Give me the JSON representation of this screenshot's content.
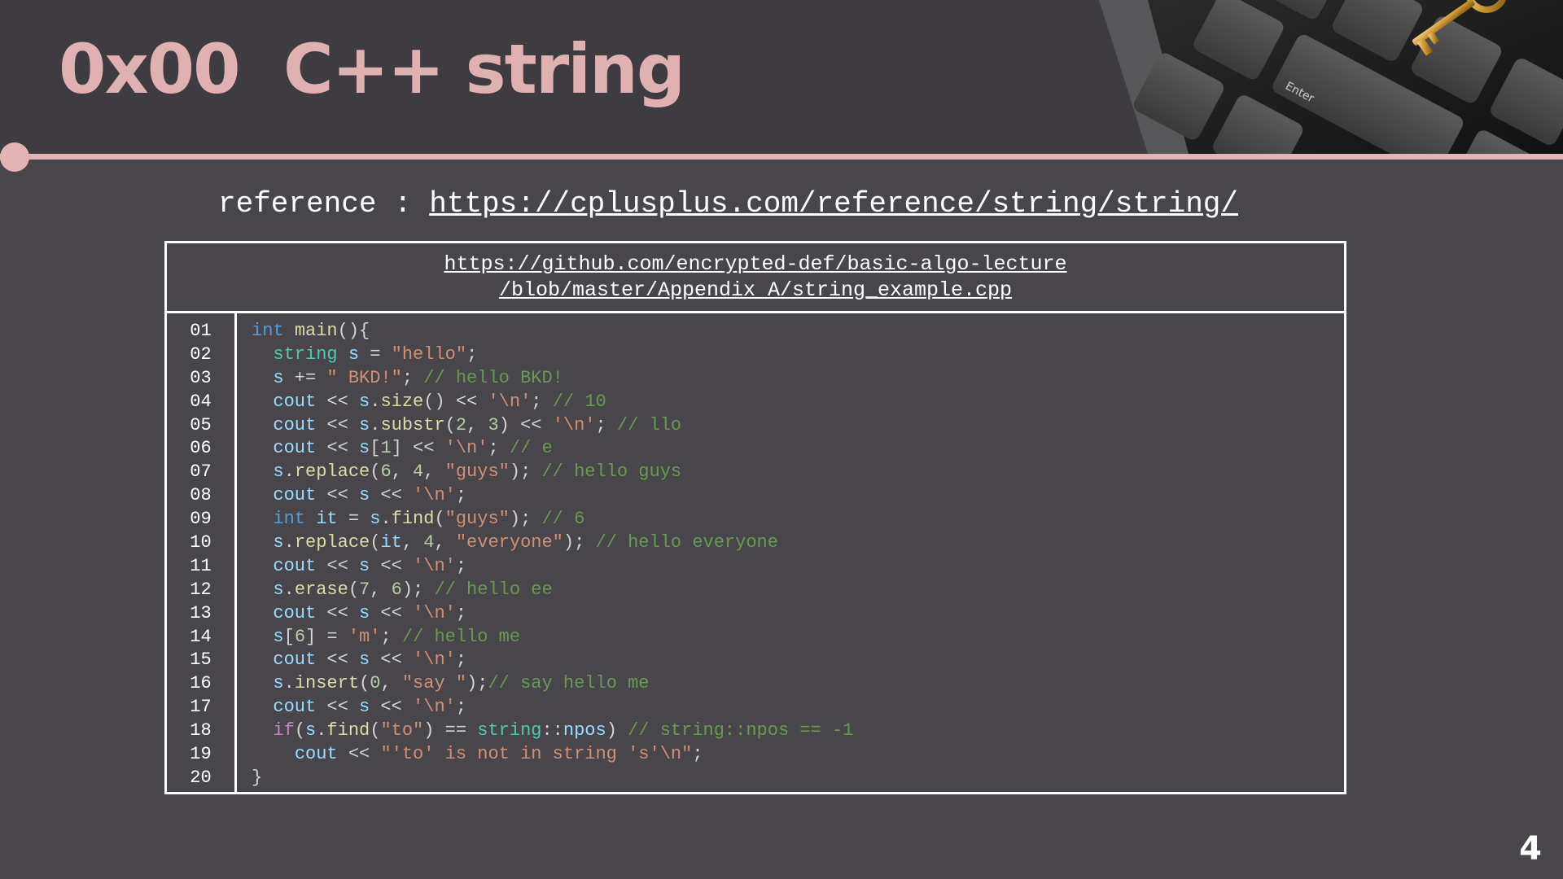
{
  "slide": {
    "title": "0x00  C++ string",
    "page_number": "4"
  },
  "reference": {
    "label": "reference : ",
    "url": "https://cplusplus.com/reference/string/string/"
  },
  "source_file": {
    "line1": "https://github.com/encrypted-def/basic-algo-lecture",
    "line2": "/blob/master/Appendix A/string_example.cpp"
  },
  "line_numbers": [
    "01",
    "02",
    "03",
    "04",
    "05",
    "06",
    "07",
    "08",
    "09",
    "10",
    "11",
    "12",
    "13",
    "14",
    "15",
    "16",
    "17",
    "18",
    "19",
    "20"
  ],
  "code_lines": [
    "int main(){",
    "  string s = \"hello\";",
    "  s += \" BKD!\"; // hello BKD!",
    "  cout << s.size() << '\\n'; // 10",
    "  cout << s.substr(2, 3) << '\\n'; // llo",
    "  cout << s[1] << '\\n'; // e",
    "  s.replace(6, 4, \"guys\"); // hello guys",
    "  cout << s << '\\n';",
    "  int it = s.find(\"guys\"); // 6",
    "  s.replace(it, 4, \"everyone\"); // hello everyone",
    "  cout << s << '\\n';",
    "  s.erase(7, 6); // hello ee",
    "  cout << s << '\\n';",
    "  s[6] = 'm'; // hello me",
    "  cout << s << '\\n';",
    "  s.insert(0, \"say \");// say hello me",
    "  cout << s << '\\n';",
    "  if(s.find(\"to\") == string::npos) // string::npos == -1",
    "    cout << \"'to' is not in string 's'\\n\";",
    "}"
  ],
  "colors": {
    "background": "#48464a",
    "header": "#3e3c40",
    "accent": "#e2b4b6",
    "keyword": "#569cd6",
    "string_literal": "#ce9178",
    "comment": "#6a9955",
    "number": "#b5cea8",
    "type": "#4ec9b0"
  },
  "icons": {
    "decoration": "keyboard-with-golden-key-image"
  }
}
